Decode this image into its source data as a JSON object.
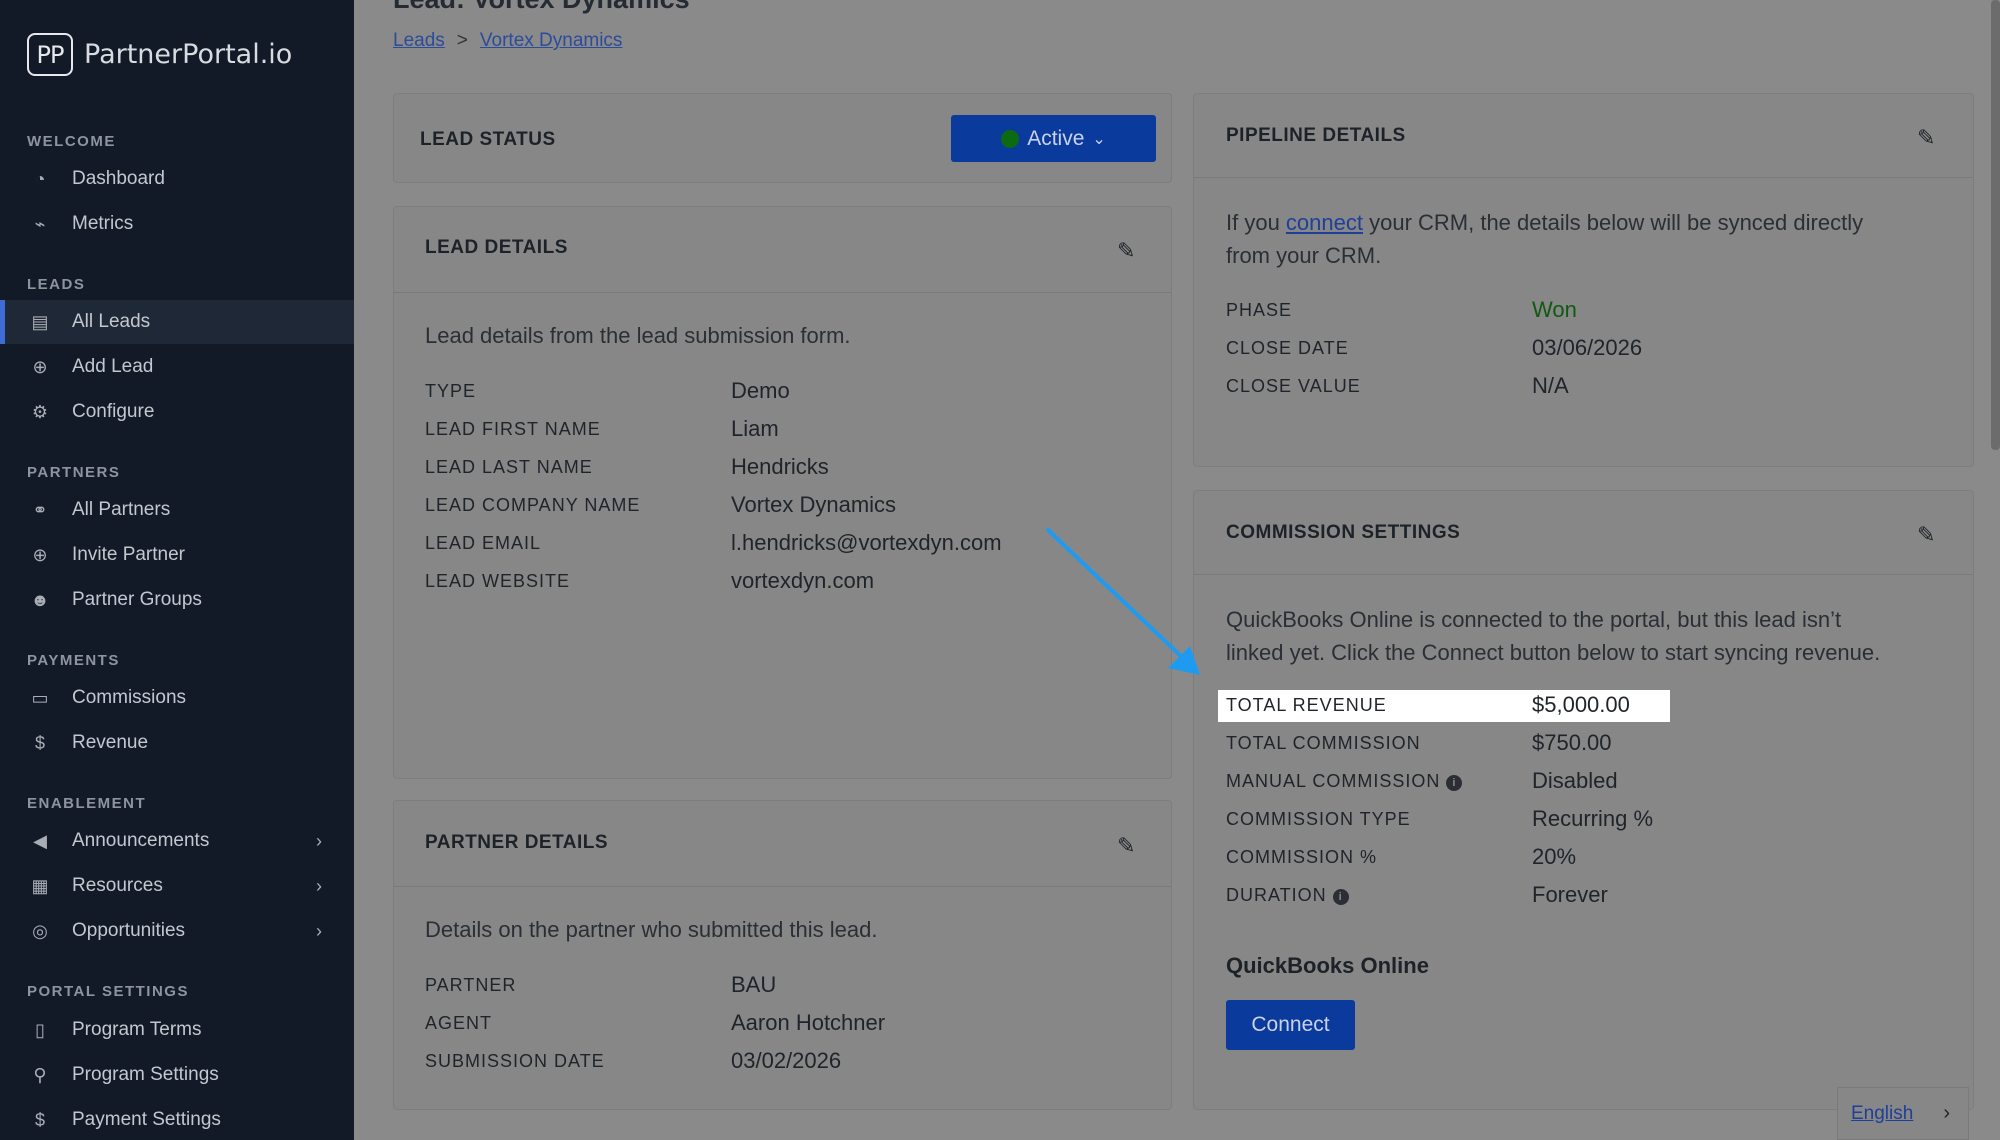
{
  "brand": {
    "logo_mark": "PP",
    "name": "PartnerPortal.io"
  },
  "sidebar": {
    "sections": {
      "welcome": "WELCOME",
      "leads": "LEADS",
      "partners": "PARTNERS",
      "payments": "PAYMENTS",
      "enablement": "ENABLEMENT",
      "portal_settings": "PORTAL SETTINGS"
    },
    "items": {
      "dashboard": "Dashboard",
      "metrics": "Metrics",
      "all_leads": "All Leads",
      "add_lead": "Add Lead",
      "configure": "Configure",
      "all_partners": "All Partners",
      "invite_partner": "Invite Partner",
      "partner_groups": "Partner Groups",
      "commissions": "Commissions",
      "revenue": "Revenue",
      "announcements": "Announcements",
      "resources": "Resources",
      "opportunities": "Opportunities",
      "program_terms": "Program Terms",
      "program_settings": "Program Settings",
      "payment_settings": "Payment Settings"
    },
    "active_item": "All Leads"
  },
  "page": {
    "title": "Lead: Vortex Dynamics",
    "breadcrumb": {
      "root": "Leads",
      "sep": ">",
      "current": "Vortex Dynamics"
    }
  },
  "lead_status": {
    "title": "LEAD STATUS",
    "value": "Active",
    "caret": "⌄"
  },
  "lead_details": {
    "title": "LEAD DETAILS",
    "description": "Lead details from the lead submission form.",
    "rows": [
      {
        "label": "TYPE",
        "value": "Demo"
      },
      {
        "label": "LEAD FIRST NAME",
        "value": "Liam"
      },
      {
        "label": "LEAD LAST NAME",
        "value": "Hendricks"
      },
      {
        "label": "LEAD COMPANY NAME",
        "value": "Vortex Dynamics"
      },
      {
        "label": "LEAD EMAIL",
        "value": "l.hendricks@vortexdyn.com"
      },
      {
        "label": "LEAD WEBSITE",
        "value": "vortexdyn.com"
      }
    ]
  },
  "partner_details": {
    "title": "PARTNER DETAILS",
    "description": "Details on the partner who submitted this lead.",
    "rows": [
      {
        "label": "PARTNER",
        "value": "BAU"
      },
      {
        "label": "AGENT",
        "value": "Aaron Hotchner"
      },
      {
        "label": "SUBMISSION DATE",
        "value": "03/02/2026"
      }
    ]
  },
  "pipeline_details": {
    "title": "PIPELINE DETAILS",
    "desc_pre": "If you ",
    "desc_link": "connect",
    "desc_post_1": " your CRM, the details below will be synced directly",
    "desc_post_2": "from your CRM.",
    "rows": [
      {
        "label": "PHASE",
        "value": "Won"
      },
      {
        "label": "CLOSE DATE",
        "value": "03/06/2026"
      },
      {
        "label": "CLOSE VALUE",
        "value": "N/A"
      }
    ]
  },
  "commission_settings": {
    "title": "COMMISSION SETTINGS",
    "desc_1": "QuickBooks Online is connected to the portal, but this lead isn’t",
    "desc_2": "linked yet. Click the Connect button below to start syncing revenue.",
    "rows": [
      {
        "label": "TOTAL REVENUE",
        "value": "$5,000.00"
      },
      {
        "label": "TOTAL COMMISSION",
        "value": "$750.00"
      },
      {
        "label": "MANUAL COMMISSION",
        "value": "Disabled"
      },
      {
        "label": "COMMISSION TYPE",
        "value": "Recurring %"
      },
      {
        "label": "COMMISSION %",
        "value": "20%"
      },
      {
        "label": "DURATION",
        "value": "Forever"
      }
    ],
    "integration_title": "QuickBooks Online",
    "connect_label": "Connect"
  },
  "language": {
    "label": "English"
  },
  "colors": {
    "accent": "#0a3a9c",
    "sidebar": "#121a28",
    "annotation_arrow": "#1e9bf0",
    "won": "#0f5a10"
  }
}
